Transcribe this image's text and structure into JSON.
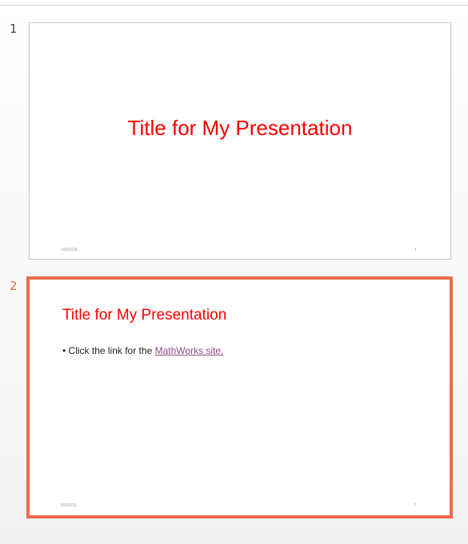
{
  "colors": {
    "title_red": "#ff0000",
    "selection_border": "#ee6b4d",
    "selected_number": "#e2694a",
    "link": "#8e4a86"
  },
  "slides": [
    {
      "number": "1",
      "title": "Title for My Presentation",
      "footer_date": "6/5/2015",
      "footer_page": "1",
      "selected": false
    },
    {
      "number": "2",
      "title": "Title for My Presentation",
      "bullet_prefix": "• Click the link for the ",
      "bullet_link": "MathWorks site.",
      "footer_date": "6/5/2015",
      "footer_page": "2",
      "selected": true
    }
  ]
}
